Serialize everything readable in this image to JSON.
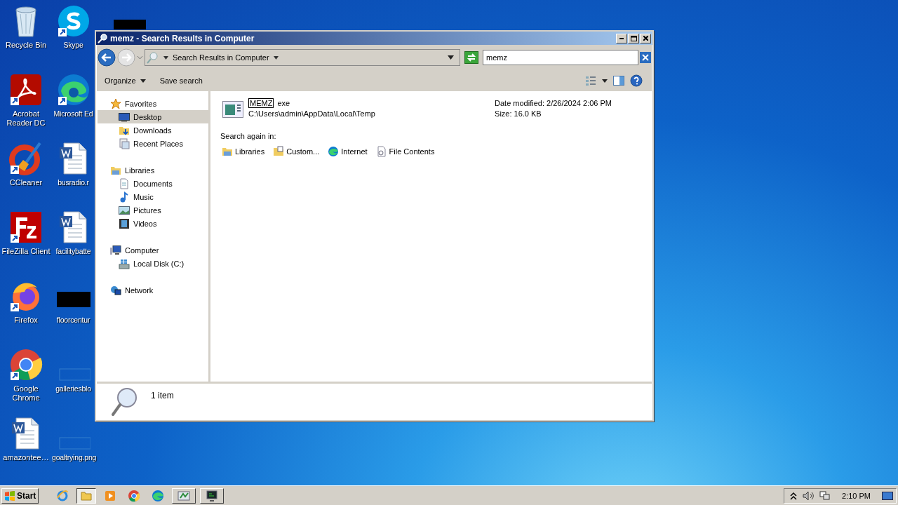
{
  "desktop_icons": [
    {
      "label": "Recycle Bin",
      "kind": "recycle",
      "shortcut": false
    },
    {
      "label": "Acrobat Reader DC",
      "kind": "acrobat",
      "shortcut": true
    },
    {
      "label": "CCleaner",
      "kind": "ccleaner",
      "shortcut": true
    },
    {
      "label": "FileZilla Client",
      "kind": "filezilla",
      "shortcut": true
    },
    {
      "label": "Firefox",
      "kind": "firefox",
      "shortcut": true
    },
    {
      "label": "Google Chrome",
      "kind": "chrome",
      "shortcut": true
    },
    {
      "label": "amazontee…",
      "kind": "word",
      "shortcut": false
    },
    {
      "label": "Skype",
      "kind": "skype",
      "shortcut": true
    },
    {
      "label": "Microsoft Ed",
      "kind": "edge",
      "shortcut": true
    },
    {
      "label": "busradio.r",
      "kind": "word",
      "shortcut": false
    },
    {
      "label": "facilitybatte",
      "kind": "word",
      "shortcut": false
    },
    {
      "label": "floorcentur",
      "kind": "dark",
      "shortcut": false
    },
    {
      "label": "galleriesblo",
      "kind": "blank",
      "shortcut": false
    },
    {
      "label": "goaltrying.png",
      "kind": "blank",
      "shortcut": false
    },
    {
      "kind": "darktop"
    }
  ],
  "window": {
    "title": "memz - Search Results in Computer",
    "address": "Search Results in Computer",
    "search": {
      "value": "memz"
    },
    "toolbar": [
      "Organize",
      "Save search"
    ],
    "sidebar": [
      {
        "label": "Favorites",
        "kind": "star",
        "selected": false,
        "children": [
          {
            "label": "Desktop",
            "kind": "desktop",
            "selected": true
          },
          {
            "label": "Downloads",
            "kind": "downloads",
            "selected": false
          },
          {
            "label": "Recent Places",
            "kind": "recent",
            "selected": false
          }
        ]
      },
      {
        "label": "Libraries",
        "kind": "libraries",
        "selected": false,
        "children": [
          {
            "label": "Documents",
            "kind": "documents",
            "selected": false
          },
          {
            "label": "Music",
            "kind": "music",
            "selected": false
          },
          {
            "label": "Pictures",
            "kind": "pictures",
            "selected": false
          },
          {
            "label": "Videos",
            "kind": "videos",
            "selected": false
          }
        ]
      },
      {
        "label": "Computer",
        "kind": "computer",
        "selected": false,
        "children": [
          {
            "label": "Local Disk (C:)",
            "kind": "disk",
            "selected": false
          }
        ]
      },
      {
        "label": "Network",
        "kind": "network",
        "selected": false
      }
    ],
    "results": [
      {
        "name": [
          {
            "text": "MEMZ",
            "highlighted": true
          },
          {
            "text": "exe",
            "highlighted": false
          }
        ],
        "path": "C:\\Users\\admin\\AppData\\Local\\Temp",
        "date": "Date modified: 2/26/2024 2:06 PM",
        "size": "Size: 16.0 KB"
      }
    ],
    "search_again_label": "Search again in:",
    "search_again": [
      {
        "label": "Libraries",
        "kind": "libraries"
      },
      {
        "label": "Custom...",
        "kind": "custom"
      },
      {
        "label": "Internet",
        "kind": "edge"
      },
      {
        "label": "File Contents",
        "kind": "contents"
      }
    ],
    "status": "1 item"
  },
  "taskbar": {
    "start": "Start",
    "apps": [
      {
        "kind": "ie",
        "selected": false
      },
      {
        "kind": "explorer",
        "selected": true
      },
      {
        "kind": "media",
        "selected": false
      },
      {
        "kind": "chrome",
        "selected": false
      },
      {
        "kind": "edge",
        "selected": false
      },
      {
        "kind": "app",
        "selected": false
      },
      {
        "kind": "monitor",
        "selected": false
      }
    ],
    "time": "2:10 PM"
  }
}
